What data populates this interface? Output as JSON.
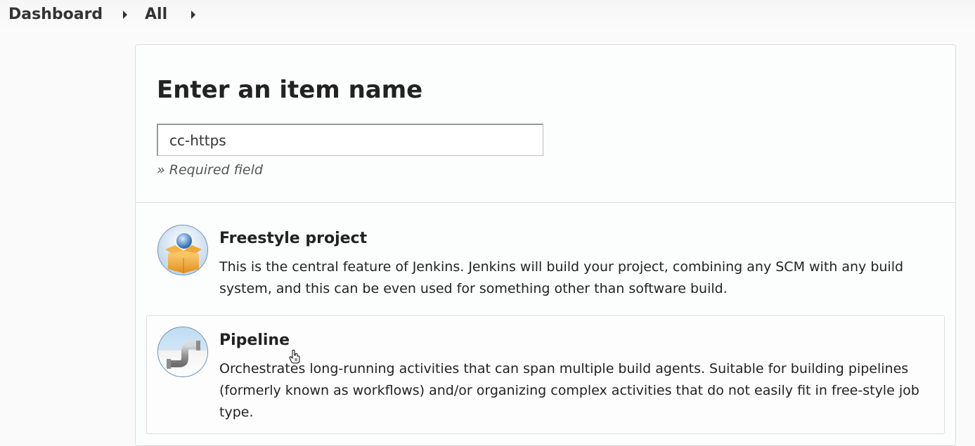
{
  "breadcrumb": {
    "items": [
      {
        "label": "Dashboard"
      },
      {
        "label": "All"
      }
    ]
  },
  "form": {
    "title": "Enter an item name",
    "item_name_value": "cc-https",
    "required_note": "» Required field"
  },
  "item_types": [
    {
      "title": "Freestyle project",
      "description": "This is the central feature of Jenkins. Jenkins will build your project, combining any SCM with any build system, and this can be even used for something other than software build.",
      "icon": "freestyle-project-box-icon"
    },
    {
      "title": "Pipeline",
      "description": "Orchestrates long-running activities that can span multiple build agents. Suitable for building pipelines (formerly known as workflows) and/or organizing complex activities that do not easily fit in free-style job type.",
      "icon": "pipeline-pipe-icon"
    }
  ],
  "colors": {
    "background": "#fafafa",
    "panel_border": "#dddddd",
    "text": "#222222",
    "muted_text": "#555555"
  }
}
